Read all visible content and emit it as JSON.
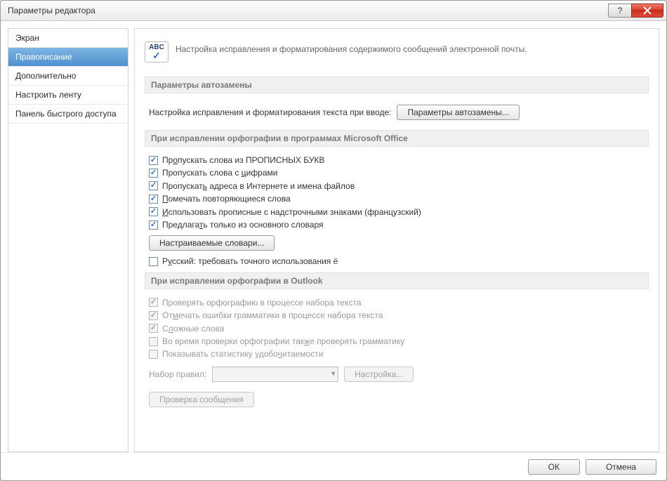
{
  "window": {
    "title": "Параметры редактора"
  },
  "titlebar_buttons": {
    "help": "?",
    "close": ""
  },
  "sidebar": {
    "items": [
      {
        "label": "Экран"
      },
      {
        "label": "Правописание"
      },
      {
        "label": "Дополнительно"
      },
      {
        "label": "Настроить ленту"
      },
      {
        "label": "Панель быстрого доступа"
      }
    ],
    "selected_index": 1
  },
  "intro": {
    "icon_abc": "ABC",
    "text": "Настройка исправления и форматирования содержимого сообщений электронной почты."
  },
  "sections": {
    "autocorrect": {
      "title": "Параметры автозамены",
      "prompt": "Настройка исправления и форматирования текста при вводе:",
      "button": "Параметры автозамены..."
    },
    "office_spell": {
      "title": "При исправлении орфографии в программах Microsoft Office",
      "options": [
        {
          "label_html": "Пр<u>о</u>пускать слова из ПРОПИСНЫХ БУКВ",
          "checked": true
        },
        {
          "label_html": "Пропускать слова с <u>ц</u>ифрами",
          "checked": true
        },
        {
          "label_html": "Пропускат<u>ь</u> адреса в Интернете и имена файлов",
          "checked": true
        },
        {
          "label_html": "<u>П</u>омечать повторяющиеся слова",
          "checked": true
        },
        {
          "label_html": "<u>И</u>спользовать прописные с надстрочными знаками (французский)",
          "checked": true
        },
        {
          "label_html": "Предлага<u>т</u>ь только из основного словаря",
          "checked": true
        }
      ],
      "dict_button": "Настраиваемые словари...",
      "extra_option": {
        "label_html": "Р<u>у</u>сский: требовать точного использования ё",
        "checked": false
      }
    },
    "outlook_spell": {
      "title": "При исправлении орфографии в Outlook",
      "options": [
        {
          "label_html": "Проверять орфографию в процессе набора текста",
          "checked": true,
          "disabled": true
        },
        {
          "label_html": "От<u>м</u>ечать ошибки грамматики в процессе набора текста",
          "checked": true,
          "disabled": true
        },
        {
          "label_html": "С<u>л</u>ожные слова",
          "checked": true,
          "disabled": true
        },
        {
          "label_html": "Во время проверки орфографии так<u>ж</u>е проверять грамматику",
          "checked": false,
          "disabled": true
        },
        {
          "label_html": "Показывать статистику удобо<u>ч</u>итаемости",
          "checked": false,
          "disabled": true
        }
      ],
      "rule_set_label": "Набор правил:",
      "rule_set_value": "",
      "settings_button": "Настройка...",
      "recheck_button": "Проверка сообщения"
    }
  },
  "footer": {
    "ok": "ОК",
    "cancel": "Отмена"
  }
}
